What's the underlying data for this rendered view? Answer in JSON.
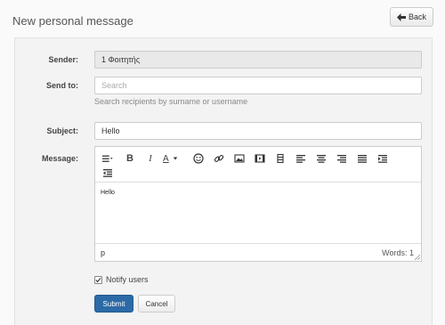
{
  "page": {
    "title": "New personal message"
  },
  "header": {
    "back_label": "Back"
  },
  "form": {
    "sender": {
      "label": "Sender:",
      "value": "1 Φοιτητής"
    },
    "send_to": {
      "label": "Send to:",
      "placeholder": "Search",
      "help": "Search recipients by surname or username"
    },
    "subject": {
      "label": "Subject:",
      "value": "Hello"
    },
    "message": {
      "label": "Message:",
      "body": "Hello",
      "path": "p",
      "word_count_label": "Words: 1"
    },
    "notify": {
      "label": "Notify users",
      "checked": true
    },
    "submit_label": "Submit",
    "cancel_label": "Cancel"
  },
  "toolbar": {
    "bold": "B",
    "italic": "I",
    "font_color": "A",
    "icons": [
      "paragraph-format-icon",
      "bold-icon",
      "italic-icon",
      "font-color-icon",
      "emoticon-icon",
      "link-icon",
      "image-icon",
      "media-icon",
      "table-icon",
      "align-left-icon",
      "align-center-icon",
      "align-right-icon",
      "justify-icon",
      "indent-icon",
      "outdent-icon"
    ]
  },
  "colors": {
    "primary": "#2c6aa7",
    "panel": "#f3f3f3",
    "border": "#cccccc"
  }
}
